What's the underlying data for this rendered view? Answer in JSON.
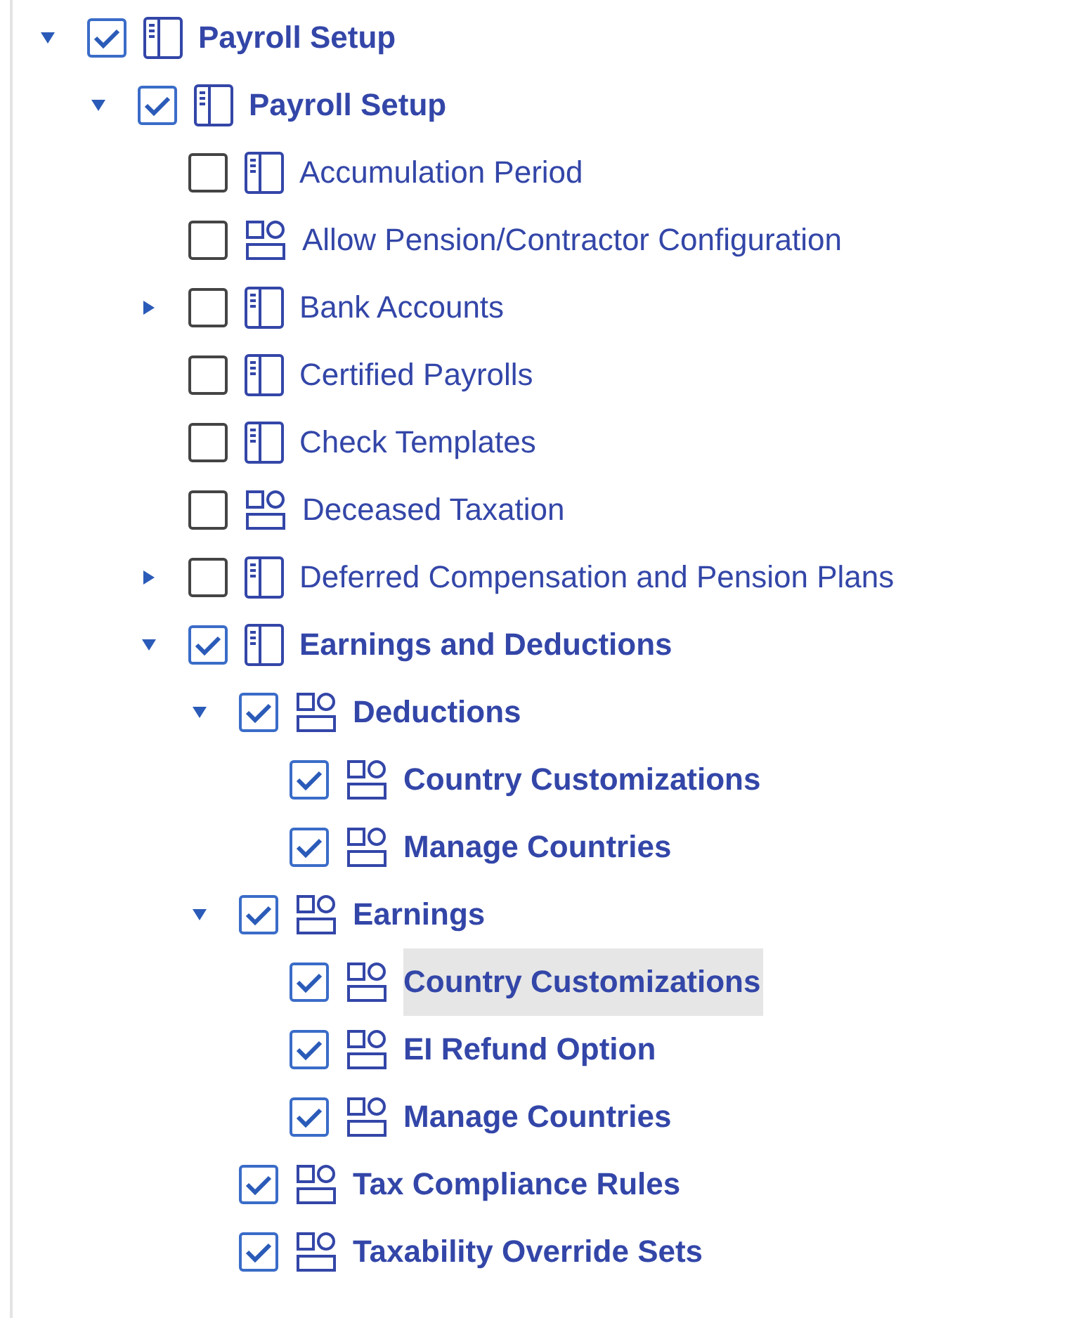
{
  "tree": [
    {
      "label": "Payroll Setup",
      "kind": "page",
      "checked": true,
      "selected": false,
      "expanded": true,
      "children": [
        {
          "label": "Payroll Setup",
          "kind": "page",
          "checked": true,
          "selected": false,
          "expanded": true,
          "children": [
            {
              "label": "Accumulation Period",
              "kind": "page",
              "checked": false,
              "selected": false
            },
            {
              "label": "Allow Pension/Contractor Configuration",
              "kind": "shapes",
              "checked": false,
              "selected": false
            },
            {
              "label": "Bank Accounts",
              "kind": "page",
              "checked": false,
              "selected": false,
              "expanded": false
            },
            {
              "label": "Certified Payrolls",
              "kind": "page",
              "checked": false,
              "selected": false
            },
            {
              "label": "Check Templates",
              "kind": "page",
              "checked": false,
              "selected": false
            },
            {
              "label": "Deceased Taxation",
              "kind": "shapes",
              "checked": false,
              "selected": false
            },
            {
              "label": "Deferred Compensation and Pension Plans",
              "kind": "page",
              "checked": false,
              "selected": false,
              "expanded": false
            },
            {
              "label": "Earnings and Deductions",
              "kind": "page",
              "checked": true,
              "selected": false,
              "expanded": true,
              "children": [
                {
                  "label": "Deductions",
                  "kind": "shapes",
                  "checked": true,
                  "selected": false,
                  "expanded": true,
                  "children": [
                    {
                      "label": "Country Customizations",
                      "kind": "shapes",
                      "checked": true,
                      "selected": false
                    },
                    {
                      "label": "Manage Countries",
                      "kind": "shapes",
                      "checked": true,
                      "selected": false
                    }
                  ]
                },
                {
                  "label": "Earnings",
                  "kind": "shapes",
                  "checked": true,
                  "selected": false,
                  "expanded": true,
                  "children": [
                    {
                      "label": "Country Customizations",
                      "kind": "shapes",
                      "checked": true,
                      "selected": true
                    },
                    {
                      "label": "EI Refund Option",
                      "kind": "shapes",
                      "checked": true,
                      "selected": false
                    },
                    {
                      "label": "Manage Countries",
                      "kind": "shapes",
                      "checked": true,
                      "selected": false
                    }
                  ]
                },
                {
                  "label": "Tax Compliance Rules",
                  "kind": "shapes",
                  "checked": true,
                  "selected": false
                },
                {
                  "label": "Taxability Override Sets",
                  "kind": "shapes",
                  "checked": true,
                  "selected": false
                }
              ]
            }
          ]
        }
      ]
    }
  ]
}
